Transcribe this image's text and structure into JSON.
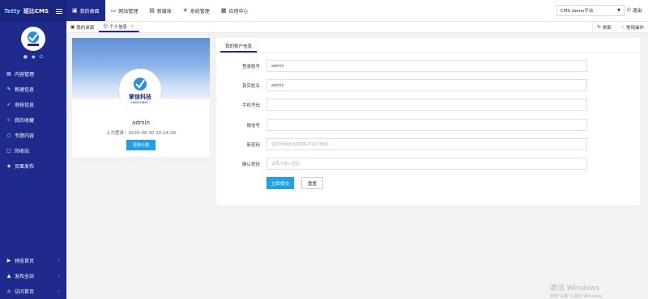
{
  "brand": {
    "badge": "Tetty",
    "title": "班比CMS"
  },
  "sidebar": {
    "user_icons": [
      "user-icon",
      "bell-icon",
      "power-icon"
    ],
    "items": [
      {
        "label": "内容管理",
        "icon": "document-icon"
      },
      {
        "label": "新建信息",
        "icon": "edit-icon"
      },
      {
        "label": "审核信息",
        "icon": "check-circle-icon"
      },
      {
        "label": "我的收藏",
        "icon": "star-icon"
      },
      {
        "label": "专题内容",
        "icon": "topic-icon"
      },
      {
        "label": "回收站",
        "icon": "recycle-icon"
      },
      {
        "label": "页面发布",
        "icon": "publish-icon"
      }
    ],
    "bottom_items": [
      {
        "label": "预览首页",
        "icon": "preview-icon"
      },
      {
        "label": "发布全站",
        "icon": "send-icon"
      },
      {
        "label": "访问首页",
        "icon": "home-icon"
      }
    ]
  },
  "topnav": {
    "items": [
      {
        "label": "我的桌面",
        "icon": "desktop-icon",
        "active": true
      },
      {
        "label": "网站管理",
        "icon": "monitor-icon"
      },
      {
        "label": "新媒体",
        "icon": "media-icon"
      },
      {
        "label": "系统管理",
        "icon": "tools-icon"
      },
      {
        "label": "应用中心",
        "icon": "app-icon"
      }
    ],
    "site_select": "CMS demo平台",
    "logout": "退出"
  },
  "tabs": {
    "items": [
      {
        "label": "我的桌面"
      },
      {
        "label": "个人信息"
      }
    ],
    "refresh": "刷新",
    "common_ops": "常用操作"
  },
  "profile": {
    "brand_cn": "掌信科技",
    "brand_en": "\"HANGXINKE.\"",
    "name": "admin",
    "last_login": "上次登录：2020-06-30 20:14:39",
    "change_avatar": "更换头像"
  },
  "form": {
    "tab": "我的账户信息",
    "fields": [
      {
        "label": "登录账号",
        "value": "admin",
        "placeholder": ""
      },
      {
        "label": "真实姓名",
        "value": "admin",
        "placeholder": ""
      },
      {
        "label": "手机号码",
        "value": "",
        "placeholder": ""
      },
      {
        "label": "微信号",
        "value": "",
        "placeholder": ""
      },
      {
        "label": "新密码",
        "value": "",
        "placeholder": "留空则保持当前密码不进行修改"
      },
      {
        "label": "确认密码",
        "value": "",
        "placeholder": "请再次输入密码"
      }
    ],
    "submit": "立即提交",
    "reset": "重置"
  },
  "watermark": {
    "line1": "激活 Windows",
    "line2": "转到\"设置\"以激活 Windows。"
  }
}
